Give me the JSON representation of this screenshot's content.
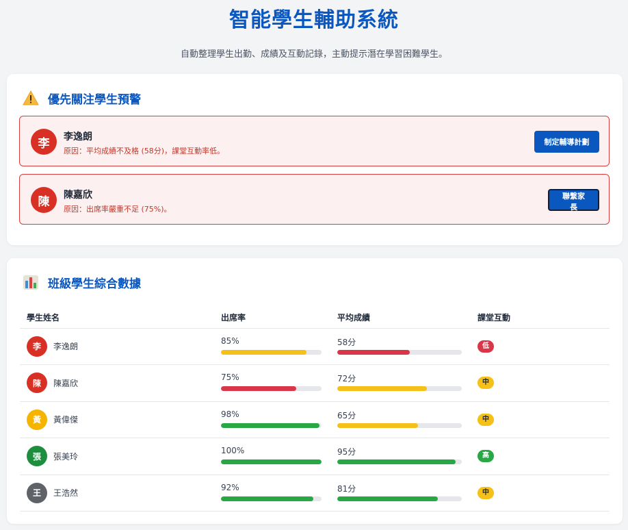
{
  "app": {
    "title": "智能學生輔助系統",
    "subtitle": "自動整理學生出勤、成績及互動記錄，主動提示潛在學習困難學生。"
  },
  "alerts_section": {
    "title": "優先關注學生預警",
    "icon": "warning-icon",
    "items": [
      {
        "initial": "李",
        "name": "李逸朗",
        "reason": "原因：平均成績不及格 (58分)，課堂互動率低。",
        "action": "制定輔導計劃"
      },
      {
        "initial": "陳",
        "name": "陳嘉欣",
        "reason": "原因：出席率嚴重不足 (75%)。",
        "action": "聯繫家長"
      }
    ]
  },
  "data_section": {
    "title": "班級學生綜合數據",
    "icon": "bar-chart-icon",
    "headers": [
      "學生姓名",
      "出席率",
      "平均成績",
      "課堂互動"
    ],
    "students": [
      {
        "initial": "李",
        "name": "李逸朗",
        "avatar_color": "#d93025",
        "attendance": "85%",
        "attendance_value": 85,
        "attendance_color": "#f5c018",
        "score": "58分",
        "score_value": 58,
        "score_color": "#d9364a",
        "interaction": "低",
        "interaction_bg": "#d9364a",
        "interaction_fg": "#ffffff"
      },
      {
        "initial": "陳",
        "name": "陳嘉欣",
        "avatar_color": "#d93025",
        "attendance": "75%",
        "attendance_value": 75,
        "attendance_color": "#d9364a",
        "score": "72分",
        "score_value": 72,
        "score_color": "#f5c018",
        "interaction": "中",
        "interaction_bg": "#f5c018",
        "interaction_fg": "#1f2937"
      },
      {
        "initial": "黃",
        "name": "黃偉傑",
        "avatar_color": "#f5b400",
        "attendance": "98%",
        "attendance_value": 98,
        "attendance_color": "#28a745",
        "score": "65分",
        "score_value": 65,
        "score_color": "#f5c018",
        "interaction": "中",
        "interaction_bg": "#f5c018",
        "interaction_fg": "#1f2937"
      },
      {
        "initial": "張",
        "name": "張美玲",
        "avatar_color": "#1e8e3e",
        "attendance": "100%",
        "attendance_value": 100,
        "attendance_color": "#28a745",
        "score": "95分",
        "score_value": 95,
        "score_color": "#28a745",
        "interaction": "高",
        "interaction_bg": "#28a745",
        "interaction_fg": "#ffffff"
      },
      {
        "initial": "王",
        "name": "王浩然",
        "avatar_color": "#5f6368",
        "attendance": "92%",
        "attendance_value": 92,
        "attendance_color": "#28a745",
        "score": "81分",
        "score_value": 81,
        "score_color": "#28a745",
        "interaction": "中",
        "interaction_bg": "#f5c018",
        "interaction_fg": "#1f2937"
      }
    ]
  }
}
